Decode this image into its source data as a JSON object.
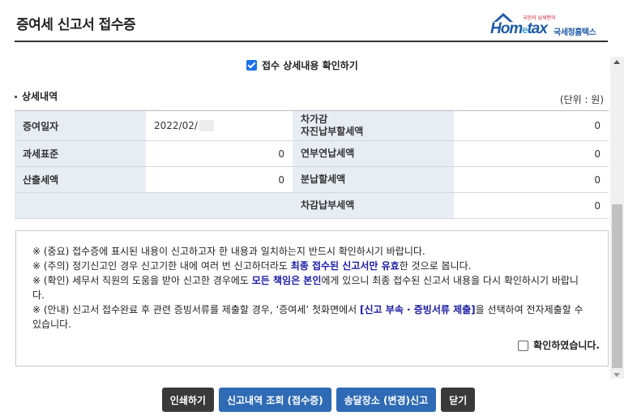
{
  "header": {
    "title": "증여세 신고서 접수증"
  },
  "logo": {
    "brand_prefix": "Hom",
    "brand_e": "e",
    "brand_suffix": "tax",
    "sub": "국세청홈택스",
    "tiny": "국민의 납세편의"
  },
  "top_confirm": {
    "label": "접수 상세내용 확인하기",
    "checked": true
  },
  "section": {
    "title": "상세내역",
    "unit": "(단위 : 원)"
  },
  "detail": {
    "rows": [
      {
        "label1": "증여일자",
        "value1": "2022/02/",
        "label2": "차가감\n자진납부할세액",
        "value2": "0"
      },
      {
        "label1": "과세표준",
        "value1": "0",
        "label2": "연부연납세액",
        "value2": "0"
      },
      {
        "label1": "산출세액",
        "value1": "0",
        "label2": "분납할세액",
        "value2": "0"
      },
      {
        "label1": "",
        "value1": "",
        "label2": "차감납부세액",
        "value2": "0"
      }
    ]
  },
  "notice": {
    "line1": "※ (중요) 접수증에 표시된 내용이 신고하고자 한 내용과 일치하는지 반드시 확인하시기 바랍니다.",
    "line2_a": "※ (주의) 정기신고인 경우 신고기한 내에 여러 번 신고하더라도 ",
    "line2_hl": "최종 접수된 신고서만 유효",
    "line2_b": "한 것으로 봅니다.",
    "line3_a": "※ (확인) 세무서 직원의 도움을 받아 신고한 경우에도 ",
    "line3_hl": "모든 책임은 본인",
    "line3_b": "에게 있으니 최종 접수된 신고서 내용을 다시 확인하시기 바랍니다.",
    "line4_a": "※ (안내) 신고서 접수완료 후 관련 증빙서류를 제출할 경우, ‘증여세’ 첫화면에서 ",
    "line4_hl": "[신고 부속 · 증빙서류 제출]",
    "line4_b": "을 선택하여 전자제출할 수 있습니다.",
    "confirm_label": "확인하였습니다.",
    "confirm_checked": false
  },
  "buttons": {
    "print": "인쇄하기",
    "history": "신고내역 조회 (접수증)",
    "address": "송달장소 (변경)신고",
    "close": "닫기"
  },
  "colors": {
    "accent_blue": "#2f6bb5",
    "dark_button": "#3a3a3a",
    "highlight": "#1a1aa6",
    "label_bg": "#e8ecf3"
  }
}
